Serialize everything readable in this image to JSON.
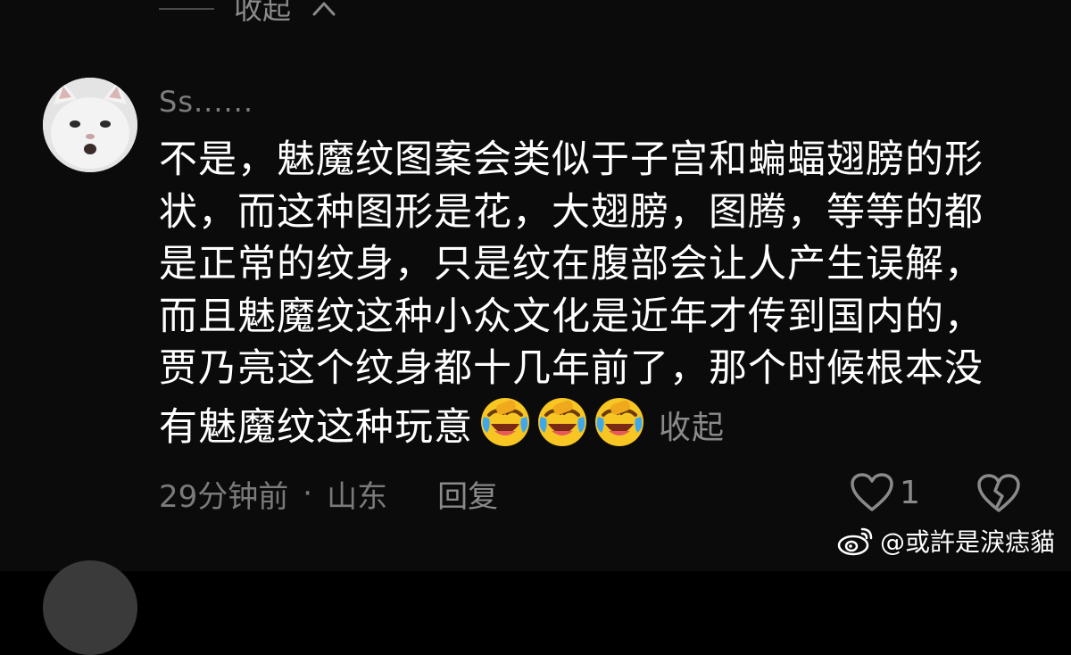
{
  "top": {
    "collapse_label": "收起"
  },
  "comment": {
    "username": "Ss......",
    "lines": [
      "不是，魅魔纹图案会类似于子宫和蝙蝠翅膀的形",
      "状，而这种图形是花，大翅膀，图腾，等等的都",
      "是正常的纹身，只是纹在腹部会让人产生误解，",
      "而且魅魔纹这种小众文化是近年才传到国内的，",
      "贾乃亮这个纹身都十几年前了，那个时候根本没",
      "有魅魔纹这种玩意"
    ],
    "emoji": [
      "crying-laughing-emoji",
      "crying-laughing-emoji",
      "crying-laughing-emoji"
    ],
    "collapse_label": "收起",
    "time": "29分钟前",
    "separator": "·",
    "location": "山东",
    "reply_label": "回复",
    "like_count": "1"
  },
  "watermark": {
    "text": "@或許是淚痣貓",
    "icon": "weibo-icon"
  },
  "colors": {
    "background": "#0b0b0b",
    "text": "#ffffff",
    "muted": "#7d7d7d",
    "emoji_yellow": "#f7c623"
  }
}
